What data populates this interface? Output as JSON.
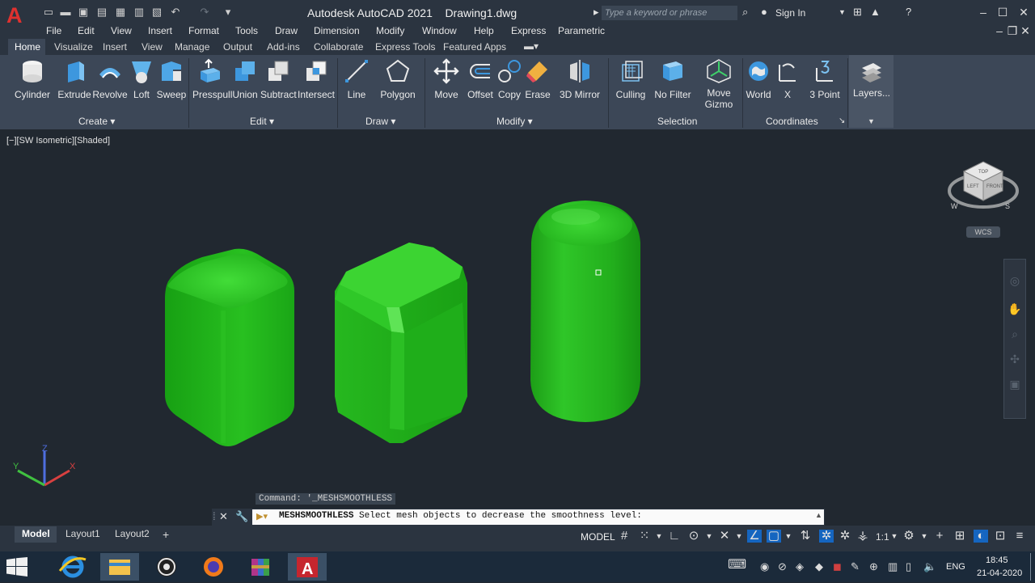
{
  "app": {
    "window_title": "Autodesk AutoCAD 2021    Drawing1.dwg",
    "search_placeholder": "Type a keyword or phrase",
    "sign_in": "Sign In"
  },
  "menu": [
    "File",
    "Edit",
    "View",
    "Insert",
    "Format",
    "Tools",
    "Draw",
    "Dimension",
    "Modify",
    "Window",
    "Help",
    "Express",
    "Parametric"
  ],
  "ribbon_tabs": [
    "Home",
    "Visualize",
    "Insert",
    "View",
    "Manage",
    "Output",
    "Add-ins",
    "Collaborate",
    "Express Tools",
    "Featured Apps"
  ],
  "ribbon": {
    "create": {
      "title": "Create",
      "buttons": [
        "Cylinder",
        "Extrude",
        "Revolve",
        "Loft",
        "Sweep"
      ]
    },
    "edit": {
      "title": "Edit",
      "buttons": [
        "Presspull",
        "Union",
        "Subtract",
        "Intersect"
      ]
    },
    "draw": {
      "title": "Draw",
      "buttons": [
        "Line",
        "Polygon"
      ]
    },
    "modify": {
      "title": "Modify",
      "buttons": [
        "Move",
        "Offset",
        "Copy",
        "Erase",
        "3D Mirror"
      ]
    },
    "selection": {
      "title": "Selection",
      "buttons": [
        "Culling",
        "No Filter",
        "Move",
        "Gizmo"
      ]
    },
    "coordinates": {
      "title": "Coordinates",
      "buttons": [
        "World",
        "X",
        "3 Point"
      ]
    },
    "layers": {
      "button": "Layers..."
    }
  },
  "viewport": {
    "label": "[−][SW Isometric][Shaded]",
    "wcs": "WCS",
    "viewcube": {
      "top": "TOP",
      "left": "LEFT",
      "front": "FRONT",
      "compass_w": "W",
      "compass_s": "S"
    },
    "ucs": {
      "x": "X",
      "y": "Y",
      "z": "Z"
    }
  },
  "command": {
    "history": "Command: '_MESHSMOOTHLESS",
    "name": "MESHSMOOTHLESS",
    "prompt": " Select mesh objects to decrease the smoothness level:"
  },
  "layout_tabs": [
    "Model",
    "Layout1",
    "Layout2"
  ],
  "status": {
    "model": "MODEL",
    "scale": "1:1"
  },
  "taskbar": {
    "time": "18:45",
    "date": "21-04-2020",
    "lang": "ENG"
  },
  "colors": {
    "mesh": "#22b21c",
    "background": "#212830",
    "ribbon": "#3c4757",
    "accent": "#1565c0"
  }
}
